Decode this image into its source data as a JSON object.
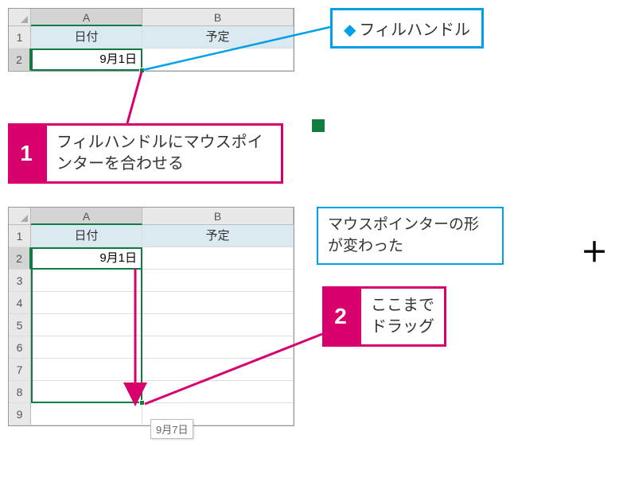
{
  "label_fillhandle": "フィルハンドル",
  "ss1": {
    "colA": "A",
    "colB": "B",
    "row1": "1",
    "row2": "2",
    "hdr_date": "日付",
    "hdr_plan": "予定",
    "val_a2": "9月1日"
  },
  "step1": {
    "num": "1",
    "text": "フィルハンドルにマウスポインターを合わせる"
  },
  "label_pointer_changed": "マウスポインターの形が変わった",
  "plus_symbol": "＋",
  "ss2": {
    "colA": "A",
    "colB": "B",
    "rows": [
      "1",
      "2",
      "3",
      "4",
      "5",
      "6",
      "7",
      "8",
      "9"
    ],
    "hdr_date": "日付",
    "hdr_plan": "予定",
    "val_a2": "9月1日",
    "tooltip": "9月7日"
  },
  "step2": {
    "num": "2",
    "text": "ここまで\nドラッグ"
  }
}
